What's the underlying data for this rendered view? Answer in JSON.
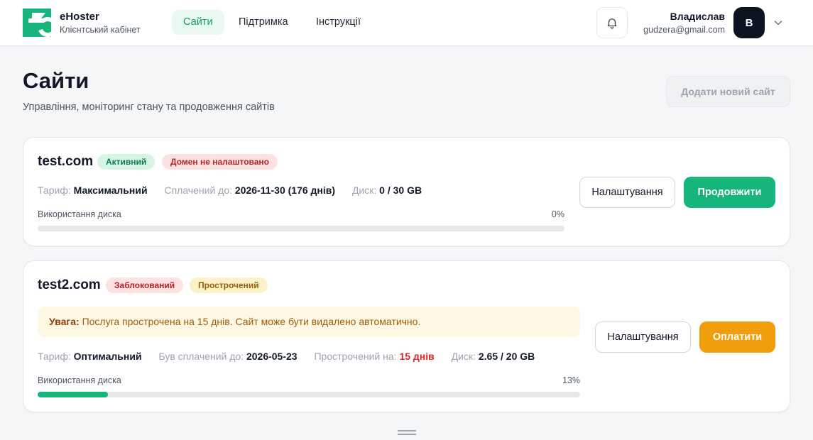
{
  "brand": {
    "name": "eHoster",
    "subtitle": "Клієнтський кабінет"
  },
  "nav": [
    {
      "label": "Сайти",
      "active": true
    },
    {
      "label": "Підтримка",
      "active": false
    },
    {
      "label": "Інструкції",
      "active": false
    }
  ],
  "user": {
    "name": "Владислав",
    "email": "gudzera@gmail.com",
    "initial": "В"
  },
  "page": {
    "title": "Сайти",
    "subtitle": "Управління, моніторинг стану та продовження сайтів",
    "add_button": "Додати новий сайт"
  },
  "sites": [
    {
      "domain": "test.com",
      "badges": [
        {
          "text": "Активний",
          "tone": "green"
        },
        {
          "text": "Домен не налаштовано",
          "tone": "red"
        }
      ],
      "tariff_label": "Тариф:",
      "tariff": "Максимальний",
      "paid_label": "Сплачений до:",
      "paid": "2026-11-30 (176 днів)",
      "disk_label": "Диск:",
      "disk": "0 / 30 GB",
      "usage_label": "Використання диска",
      "usage_text": "0%",
      "usage_fraction": 0,
      "settings_button": "Налаштування",
      "action_button": "Продовжити"
    },
    {
      "domain": "test2.com",
      "badges": [
        {
          "text": "Заблокований",
          "tone": "red"
        },
        {
          "text": "Прострочений",
          "tone": "yellow"
        }
      ],
      "warning_title": "Увага:",
      "warning_text": "Послуга прострочена на 15 днів. Сайт може бути видалено автоматично.",
      "tariff_label": "Тариф:",
      "tariff": "Оптимальний",
      "paid_label": "Був сплачений до:",
      "paid": "2026-05-23",
      "overdue_label": "Прострочений на:",
      "overdue": "15 днів",
      "disk_label": "Диск:",
      "disk": "2.65 / 20 GB",
      "usage_label": "Використання диска",
      "usage_text": "13%",
      "usage_fraction": 0.13,
      "settings_button": "Налаштування",
      "action_button": "Оплатити"
    }
  ],
  "colors": {
    "accent": "#16b67a",
    "warning": "#f29d0c",
    "danger": "#dc2626",
    "dark": "#0b1220"
  },
  "icons": {
    "logo": "ehoster-logo-icon",
    "bell": "bell-icon",
    "chevron": "chevron-down-icon",
    "grip": "drag-handle-icon"
  }
}
